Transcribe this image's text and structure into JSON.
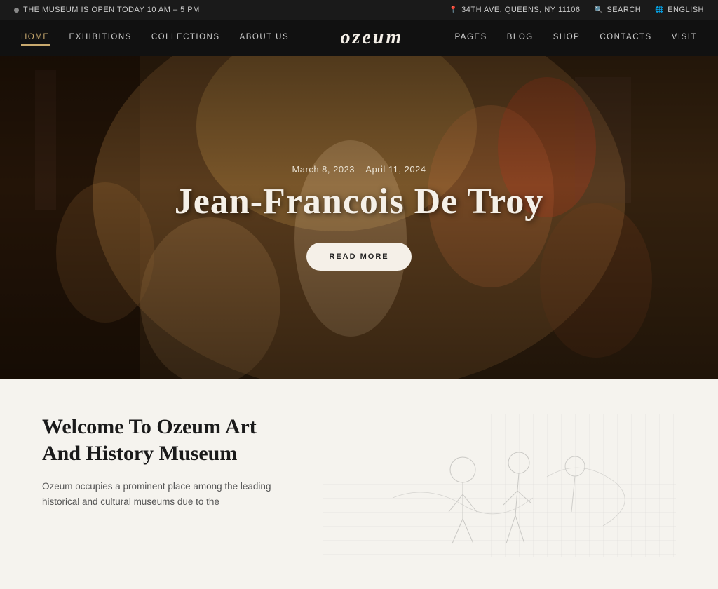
{
  "topbar": {
    "museum_hours": "THE MUSEUM IS OPEN TODAY 10 AM – 5 PM",
    "address": "34TH AVE, QUEENS, NY 11106",
    "search_label": "SEARCH",
    "language_label": "ENGLISH"
  },
  "navbar": {
    "logo": "ozeum",
    "nav_left": [
      {
        "label": "HOME",
        "active": true
      },
      {
        "label": "EXHIBITIONS",
        "active": false
      },
      {
        "label": "COLLECTIONS",
        "active": false
      },
      {
        "label": "ABOUT US",
        "active": false
      }
    ],
    "nav_right": [
      {
        "label": "PAGES",
        "active": false
      },
      {
        "label": "BLOG",
        "active": false
      },
      {
        "label": "SHOP",
        "active": false
      },
      {
        "label": "CONTACTS",
        "active": false
      },
      {
        "label": "VISIT",
        "active": false
      }
    ]
  },
  "hero": {
    "date": "March 8, 2023 – April 11, 2024",
    "title": "Jean-Francois De Troy",
    "button_label": "READ MORE"
  },
  "welcome": {
    "title": "Welcome To Ozeum Art And History Museum",
    "description": "Ozeum occupies a prominent place among the leading historical and cultural museums due to the"
  }
}
